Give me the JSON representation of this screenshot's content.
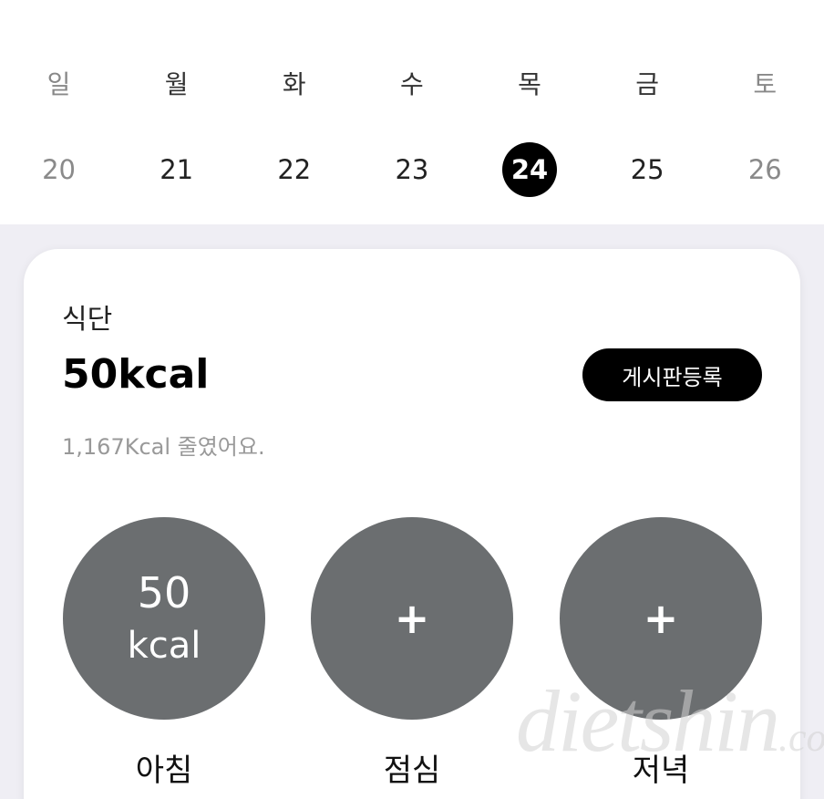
{
  "week": {
    "weekdays": [
      "일",
      "월",
      "화",
      "수",
      "목",
      "금",
      "토"
    ],
    "dates": [
      "20",
      "21",
      "22",
      "23",
      "24",
      "25",
      "26"
    ],
    "selected_index": 4
  },
  "card": {
    "title": "식단",
    "total_kcal": "50kcal",
    "board_button_label": "게시판등록",
    "reduce_note": "1,167Kcal 줄였어요."
  },
  "meals": [
    {
      "label": "아침",
      "value": "50",
      "unit": "kcal"
    },
    {
      "label": "점심",
      "plus": "+"
    },
    {
      "label": "저녁",
      "plus": "+"
    }
  ],
  "watermark": {
    "main": "dietshin",
    "suffix": ".com"
  },
  "colors": {
    "selected_date_bg": "#000000",
    "meal_circle": "#6b6e70",
    "page_bg": "#efeef4",
    "muted_text": "#999999"
  }
}
